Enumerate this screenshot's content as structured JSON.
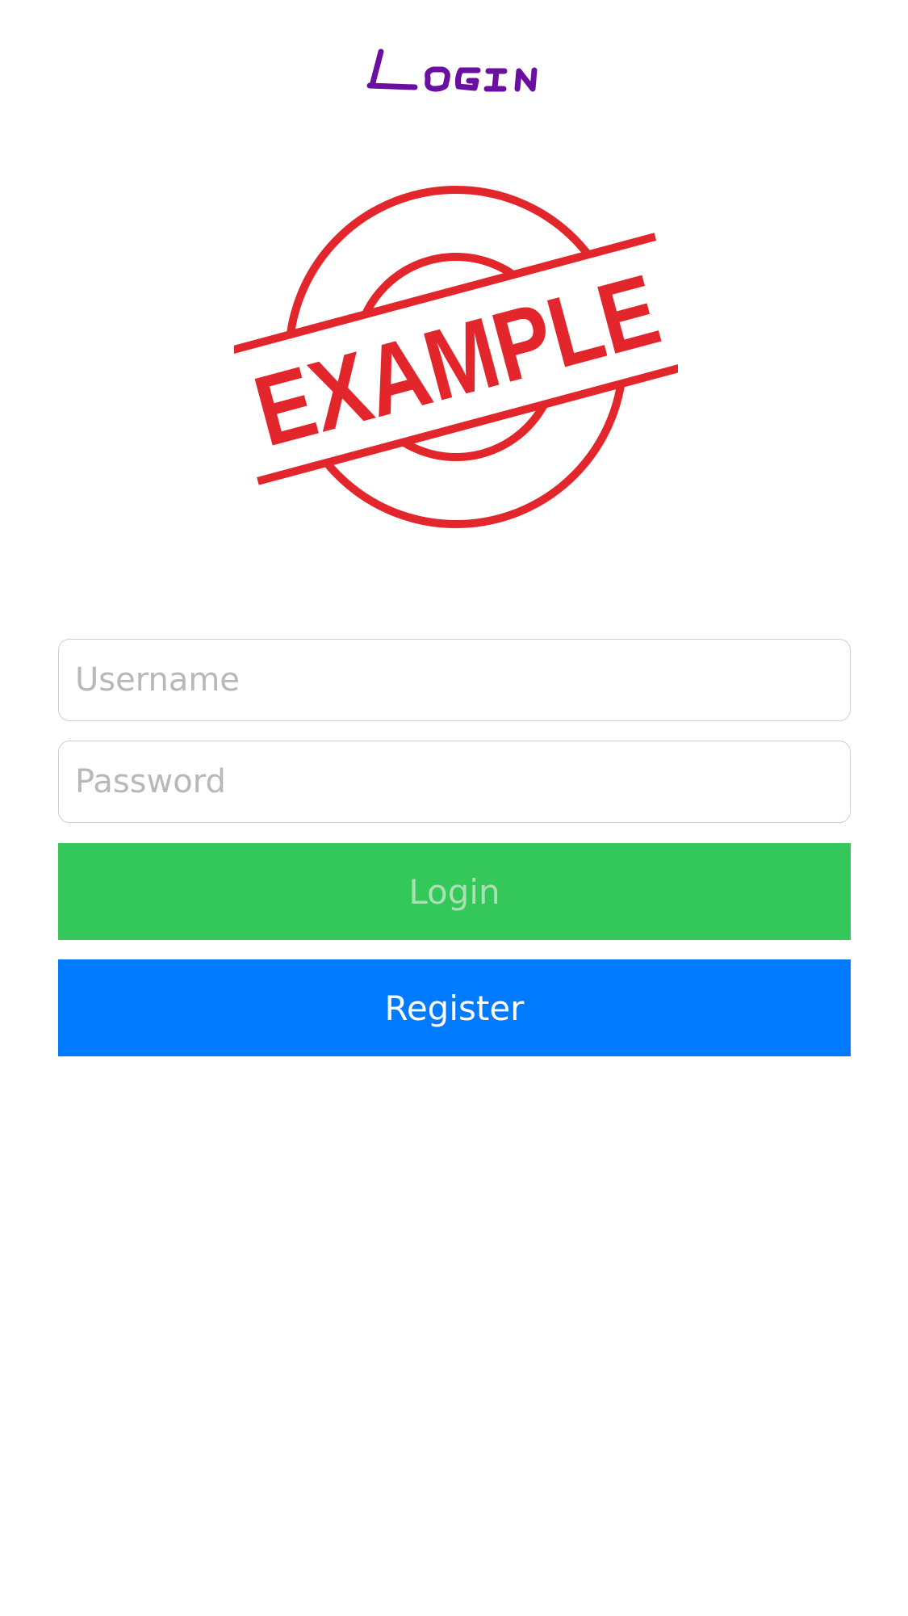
{
  "header": {
    "title": "Login"
  },
  "logo": {
    "stamp_text": "EXAMPLE",
    "stamp_color": "#e3262b"
  },
  "form": {
    "username": {
      "placeholder": "Username",
      "value": ""
    },
    "password": {
      "placeholder": "Password",
      "value": ""
    },
    "login_label": "Login",
    "register_label": "Register"
  },
  "colors": {
    "title": "#6b0fa0",
    "login_bg": "#34c759",
    "login_text": "#a8e0b4",
    "register_bg": "#007aff",
    "register_text": "#ffffff",
    "placeholder": "#b8b8b8",
    "field_border": "#cfcfcf"
  }
}
